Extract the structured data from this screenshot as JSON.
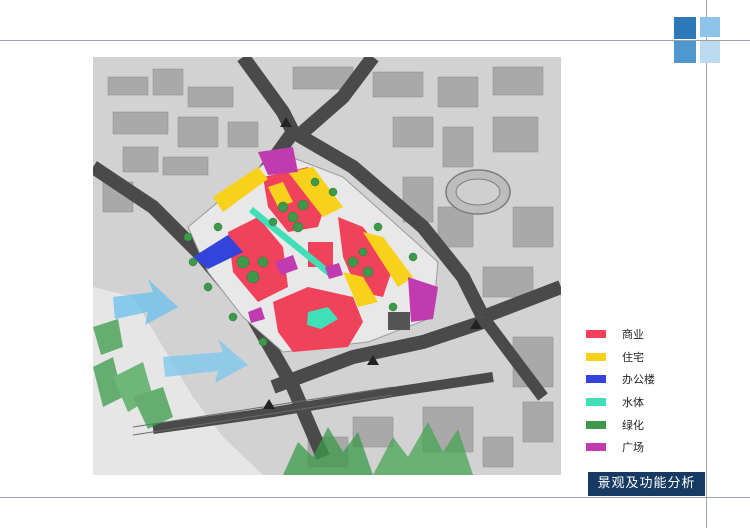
{
  "legend": {
    "items": [
      {
        "label": "商业",
        "color": "#f0425a"
      },
      {
        "label": "住宅",
        "color": "#f8d21a"
      },
      {
        "label": "办公楼",
        "color": "#3344dd"
      },
      {
        "label": "水体",
        "color": "#3fe0b8"
      },
      {
        "label": "绿化",
        "color": "#3c9a4a"
      },
      {
        "label": "广场",
        "color": "#c03ab0"
      }
    ]
  },
  "caption": "景观及功能分析",
  "colors": {
    "commercial": "#f0425a",
    "residential": "#f8d21a",
    "office": "#3344dd",
    "water": "#3fe0b8",
    "green": "#3c9a4a",
    "plaza": "#c03ab0",
    "caption_bg": "#163a63",
    "road": "#4a4a4a",
    "map_bg": "#cfcfcf"
  }
}
